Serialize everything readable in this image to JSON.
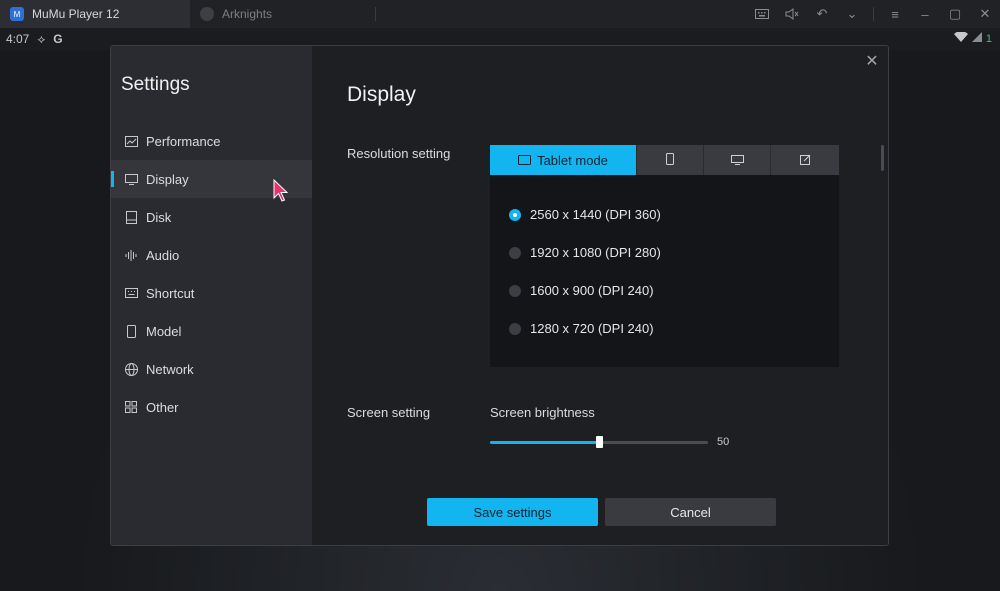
{
  "titlebar": {
    "active_tab": "MuMu Player 12",
    "inactive_tab": "Arknights"
  },
  "statusbar": {
    "time": "4:07",
    "badge": "1"
  },
  "settings": {
    "title": "Settings",
    "nav": [
      {
        "label": "Performance",
        "icon": "performance-icon"
      },
      {
        "label": "Display",
        "icon": "display-icon"
      },
      {
        "label": "Disk",
        "icon": "disk-icon"
      },
      {
        "label": "Audio",
        "icon": "audio-icon"
      },
      {
        "label": "Shortcut",
        "icon": "keyboard-icon"
      },
      {
        "label": "Model",
        "icon": "phone-icon"
      },
      {
        "label": "Network",
        "icon": "globe-icon"
      },
      {
        "label": "Other",
        "icon": "grid-icon"
      }
    ],
    "active_nav": "Display"
  },
  "display": {
    "page_title": "Display",
    "resolution_label": "Resolution setting",
    "modes": [
      {
        "label": "Tablet mode",
        "icon": "tablet-icon",
        "active": true
      },
      {
        "label": "",
        "icon": "phone-icon",
        "active": false
      },
      {
        "label": "",
        "icon": "monitor-icon",
        "active": false
      },
      {
        "label": "",
        "icon": "edit-icon",
        "active": false
      }
    ],
    "resolutions": [
      {
        "label": "2560 x 1440 (DPI 360)",
        "checked": true
      },
      {
        "label": "1920 x 1080 (DPI 280)",
        "checked": false
      },
      {
        "label": "1600 x 900 (DPI 240)",
        "checked": false
      },
      {
        "label": "1280 x 720 (DPI 240)",
        "checked": false
      }
    ],
    "screen_label": "Screen setting",
    "brightness_label": "Screen brightness",
    "brightness_value": "50",
    "brightness_fraction": 0.5
  },
  "footer": {
    "save_label": "Save settings",
    "cancel_label": "Cancel"
  },
  "colors": {
    "accent": "#12b5f0",
    "cursor": "#e8336f"
  }
}
